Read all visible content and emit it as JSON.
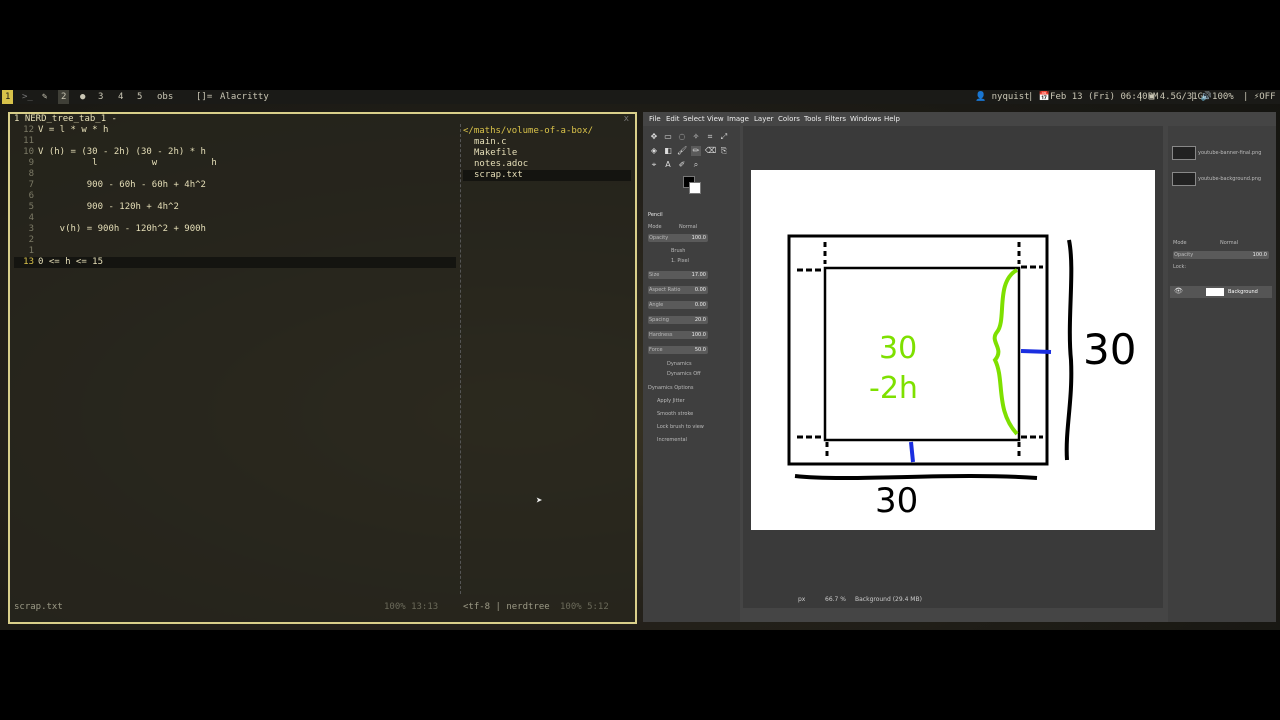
{
  "topbar": {
    "ws1": "1",
    "ws_term_icon": ">_",
    "ws_brush_icon": "✎",
    "ws2": "2",
    "ws_web_icon": "●",
    "ws3": "3",
    "ws4": "4",
    "ws5": "5",
    "ws_obs": "obs",
    "layout_icon": "[]=",
    "window_title": "Alacritty",
    "user": "nyquist",
    "date": "Feb 13 (Fri) 06:40PM",
    "memory": "4.5G/31G",
    "volume": "100%",
    "power": "OFF"
  },
  "terminal": {
    "title": "1 NERD_tree_tab_1 -",
    "close": "x",
    "lines": [
      {
        "n": "12",
        "t": "V = l * w * h"
      },
      {
        "n": "11",
        "t": ""
      },
      {
        "n": "10",
        "t": "V (h) = (30 - 2h) (30 - 2h) * h"
      },
      {
        "n": "9",
        "t": "          l          w          h"
      },
      {
        "n": "8",
        "t": ""
      },
      {
        "n": "7",
        "t": "         900 - 60h - 60h + 4h^2"
      },
      {
        "n": "6",
        "t": ""
      },
      {
        "n": "5",
        "t": "         900 - 120h + 4h^2"
      },
      {
        "n": "4",
        "t": ""
      },
      {
        "n": "3",
        "t": "    v(h) = 900h - 120h^2 + 900h"
      },
      {
        "n": "2",
        "t": ""
      },
      {
        "n": "1",
        "t": ""
      },
      {
        "n": "13",
        "t": "0 <= h <= 15"
      }
    ],
    "tree": {
      "root": "</maths/volume-of-a-box/",
      "items": [
        "main.c",
        "Makefile",
        "notes.adoc",
        "scrap.txt"
      ]
    },
    "status_file": "scrap.txt",
    "status_pos": "100%   13:13",
    "status_tree": "<tf-8 | nerdtree",
    "status_tree_pos": "100%   5:12"
  },
  "gimp": {
    "menu": [
      "File",
      "Edit",
      "Select",
      "View",
      "Image",
      "Layer",
      "Colors",
      "Tools",
      "Filters",
      "Windows",
      "Help"
    ],
    "tool_options": {
      "title": "Pencil",
      "mode_label": "Mode",
      "mode_value": "Normal",
      "opacity_label": "Opacity",
      "opacity_value": "100.0",
      "brush_label": "Brush",
      "brush_value": "1. Pixel",
      "size_label": "Size",
      "size_value": "17.00",
      "aspect_label": "Aspect Ratio",
      "aspect_value": "0.00",
      "angle_label": "Angle",
      "angle_value": "0.00",
      "spacing_label": "Spacing",
      "spacing_value": "20.0",
      "hardness_label": "Hardness",
      "hardness_value": "100.0",
      "force_label": "Force",
      "force_value": "50.0",
      "dynamics_label": "Dynamics",
      "dynamics_value": "Dynamics Off",
      "dynamics_options": "Dynamics Options",
      "apply_jitter": "Apply Jitter",
      "smooth_stroke": "Smooth stroke",
      "lock_brush": "Lock brush to view",
      "incremental": "Incremental"
    },
    "status_unit": "px",
    "status_zoom": "66.7 %",
    "status_layer": "Background (29.4 MB)",
    "right_dock": {
      "brush1": "youtube-banner-final.png",
      "brush2": "youtube-background.png",
      "mode_label": "Mode",
      "mode_value": "Normal",
      "opacity_label": "Opacity",
      "opacity_value": "100.0",
      "lock_label": "Lock:",
      "layer_name": "Background"
    },
    "drawing": {
      "label_side": "30",
      "label_bottom": "30",
      "label_inner1": "30",
      "label_inner2": "-2h"
    },
    "colors": {
      "green": "#7ee000",
      "blue": "#1a2ee0",
      "black": "#000000"
    }
  }
}
